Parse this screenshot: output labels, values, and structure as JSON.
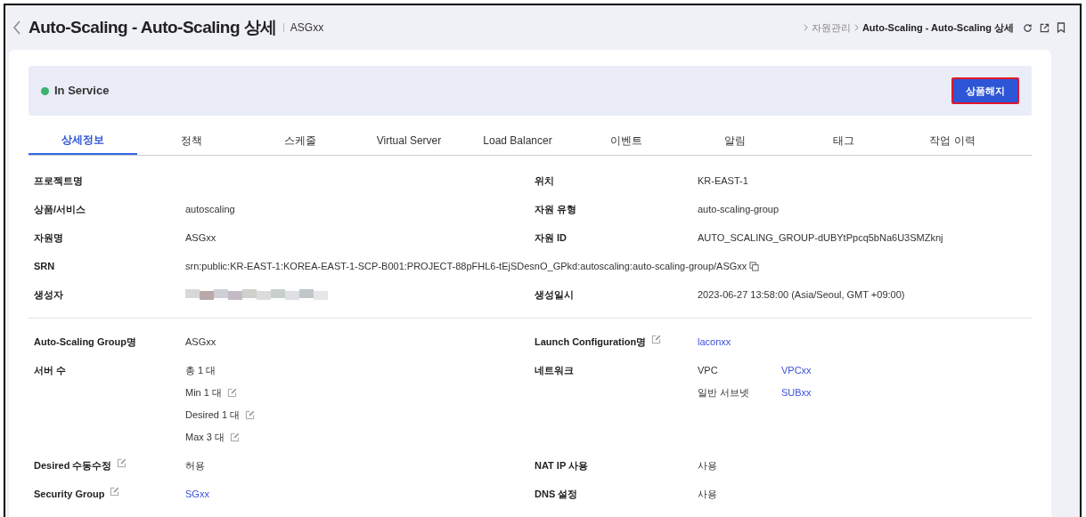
{
  "header": {
    "title": "Auto-Scaling - Auto-Scaling 상세",
    "subtitle": "ASGxx",
    "breadcrumb": [
      {
        "text": "자원관리",
        "current": false
      },
      {
        "text": "Auto-Scaling - Auto-Scaling 상세",
        "current": true
      }
    ]
  },
  "status": {
    "text": "In Service",
    "color": "#3cb371",
    "button": "상품해지"
  },
  "tabs": [
    {
      "label": "상세정보",
      "selected": true
    },
    {
      "label": "정책",
      "selected": false
    },
    {
      "label": "스케줄",
      "selected": false
    },
    {
      "label": "Virtual Server",
      "selected": false
    },
    {
      "label": "Load Balancer",
      "selected": false
    },
    {
      "label": "이벤트",
      "selected": false
    },
    {
      "label": "알림",
      "selected": false
    },
    {
      "label": "태그",
      "selected": false
    },
    {
      "label": "작업 이력",
      "selected": false
    }
  ],
  "sections": [
    {
      "rows": [
        {
          "left": {
            "label": "프로젝트명"
          },
          "right": {
            "label": "위치",
            "values": [
              {
                "kind": "text",
                "text": "KR-EAST-1"
              }
            ]
          }
        },
        {
          "left": {
            "label": "상품/서비스",
            "values": [
              {
                "kind": "text",
                "text": "autoscaling"
              }
            ]
          },
          "right": {
            "label": "자원 유형",
            "values": [
              {
                "kind": "text",
                "text": "auto-scaling-group"
              }
            ]
          }
        },
        {
          "left": {
            "label": "자원명",
            "values": [
              {
                "kind": "text",
                "text": "ASGxx"
              }
            ]
          },
          "right": {
            "label": "자원 ID",
            "values": [
              {
                "kind": "text",
                "text": "AUTO_SCALING_GROUP-dUBYtPpcq5bNa6U3SMZknj"
              }
            ]
          }
        },
        {
          "left": {
            "label": "SRN",
            "values": [
              {
                "kind": "text",
                "text": "srn:public:KR-EAST-1:KOREA-EAST-1-SCP-B001:PROJECT-88pFHL6-tEjSDesnO_GPkd:autoscaling:auto-scaling-group/ASGxx",
                "copyable": true
              }
            ]
          }
        },
        {
          "left": {
            "label": "생성자",
            "values": [
              {
                "kind": "redacted"
              }
            ]
          },
          "right": {
            "label": "생성일시",
            "values": [
              {
                "kind": "text",
                "text": "2023-06-27 13:58:00 (Asia/Seoul, GMT +09:00)"
              }
            ]
          }
        }
      ]
    },
    {
      "rows": [
        {
          "left": {
            "label": "Auto-Scaling Group명",
            "values": [
              {
                "kind": "text",
                "text": "ASGxx"
              }
            ]
          },
          "right": {
            "label": "Launch Configuration명",
            "editable": true,
            "values": [
              {
                "kind": "link",
                "text": "laconxx"
              }
            ]
          }
        },
        {
          "left": {
            "label": "서버 수",
            "values": [
              {
                "kind": "text",
                "text": "총 1 대"
              },
              {
                "kind": "text",
                "text": "Min 1 대",
                "editable": true
              },
              {
                "kind": "text",
                "text": "Desired 1 대",
                "editable": true
              },
              {
                "kind": "text",
                "text": "Max 3 대",
                "editable": true
              }
            ]
          },
          "right": {
            "label": "네트워크",
            "values": [
              {
                "kind": "pair",
                "name": "VPC",
                "text": "VPCxx"
              },
              {
                "kind": "pair",
                "name": "일반 서브넷",
                "text": "SUBxx"
              }
            ]
          }
        },
        {
          "left": {
            "label": "Desired 수동수정",
            "editable": true,
            "values": [
              {
                "kind": "text",
                "text": "허용"
              }
            ]
          },
          "right": {
            "label": "NAT IP 사용",
            "values": [
              {
                "kind": "text",
                "text": "사용"
              }
            ]
          }
        },
        {
          "left": {
            "label": "Security Group",
            "editable": true,
            "values": [
              {
                "kind": "link",
                "text": "SGxx"
              }
            ]
          },
          "right": {
            "label": "DNS 설정",
            "values": [
              {
                "kind": "text",
                "text": "사용"
              }
            ]
          }
        }
      ]
    }
  ]
}
